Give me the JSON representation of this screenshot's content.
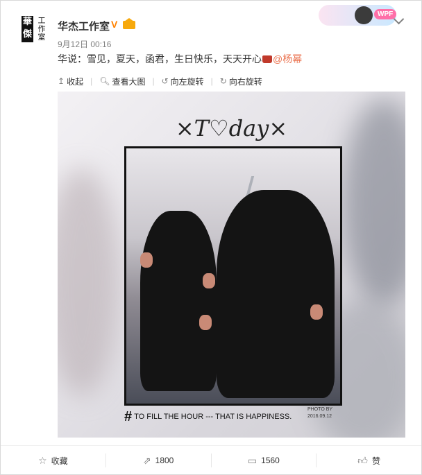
{
  "post": {
    "author": "华杰工作室",
    "avatar_seal": "華傑",
    "avatar_text": "工作室",
    "timestamp": "9月12日 00:16",
    "text_prefix": "华说：雪见，夏天，函君，生日快乐，天天开心",
    "mention": "@杨幂"
  },
  "toolbar": {
    "collapse_label": "收起",
    "view_large_label": "查看大图",
    "rotate_left_label": "向左旋转",
    "rotate_right_label": "向右旋转"
  },
  "photo": {
    "headline": "×T♡day×",
    "caption": "TO FILL THE HOUR --- THAT IS HAPPINESS.",
    "caption_hash": "#",
    "photo_by": "PHOTO BY",
    "photo_date": "2016.09.12"
  },
  "footer": {
    "favorite_label": "收藏",
    "repost_count": "1800",
    "comment_count": "1560",
    "like_label": "赞"
  },
  "decor": {
    "badge_text": "WPF"
  }
}
